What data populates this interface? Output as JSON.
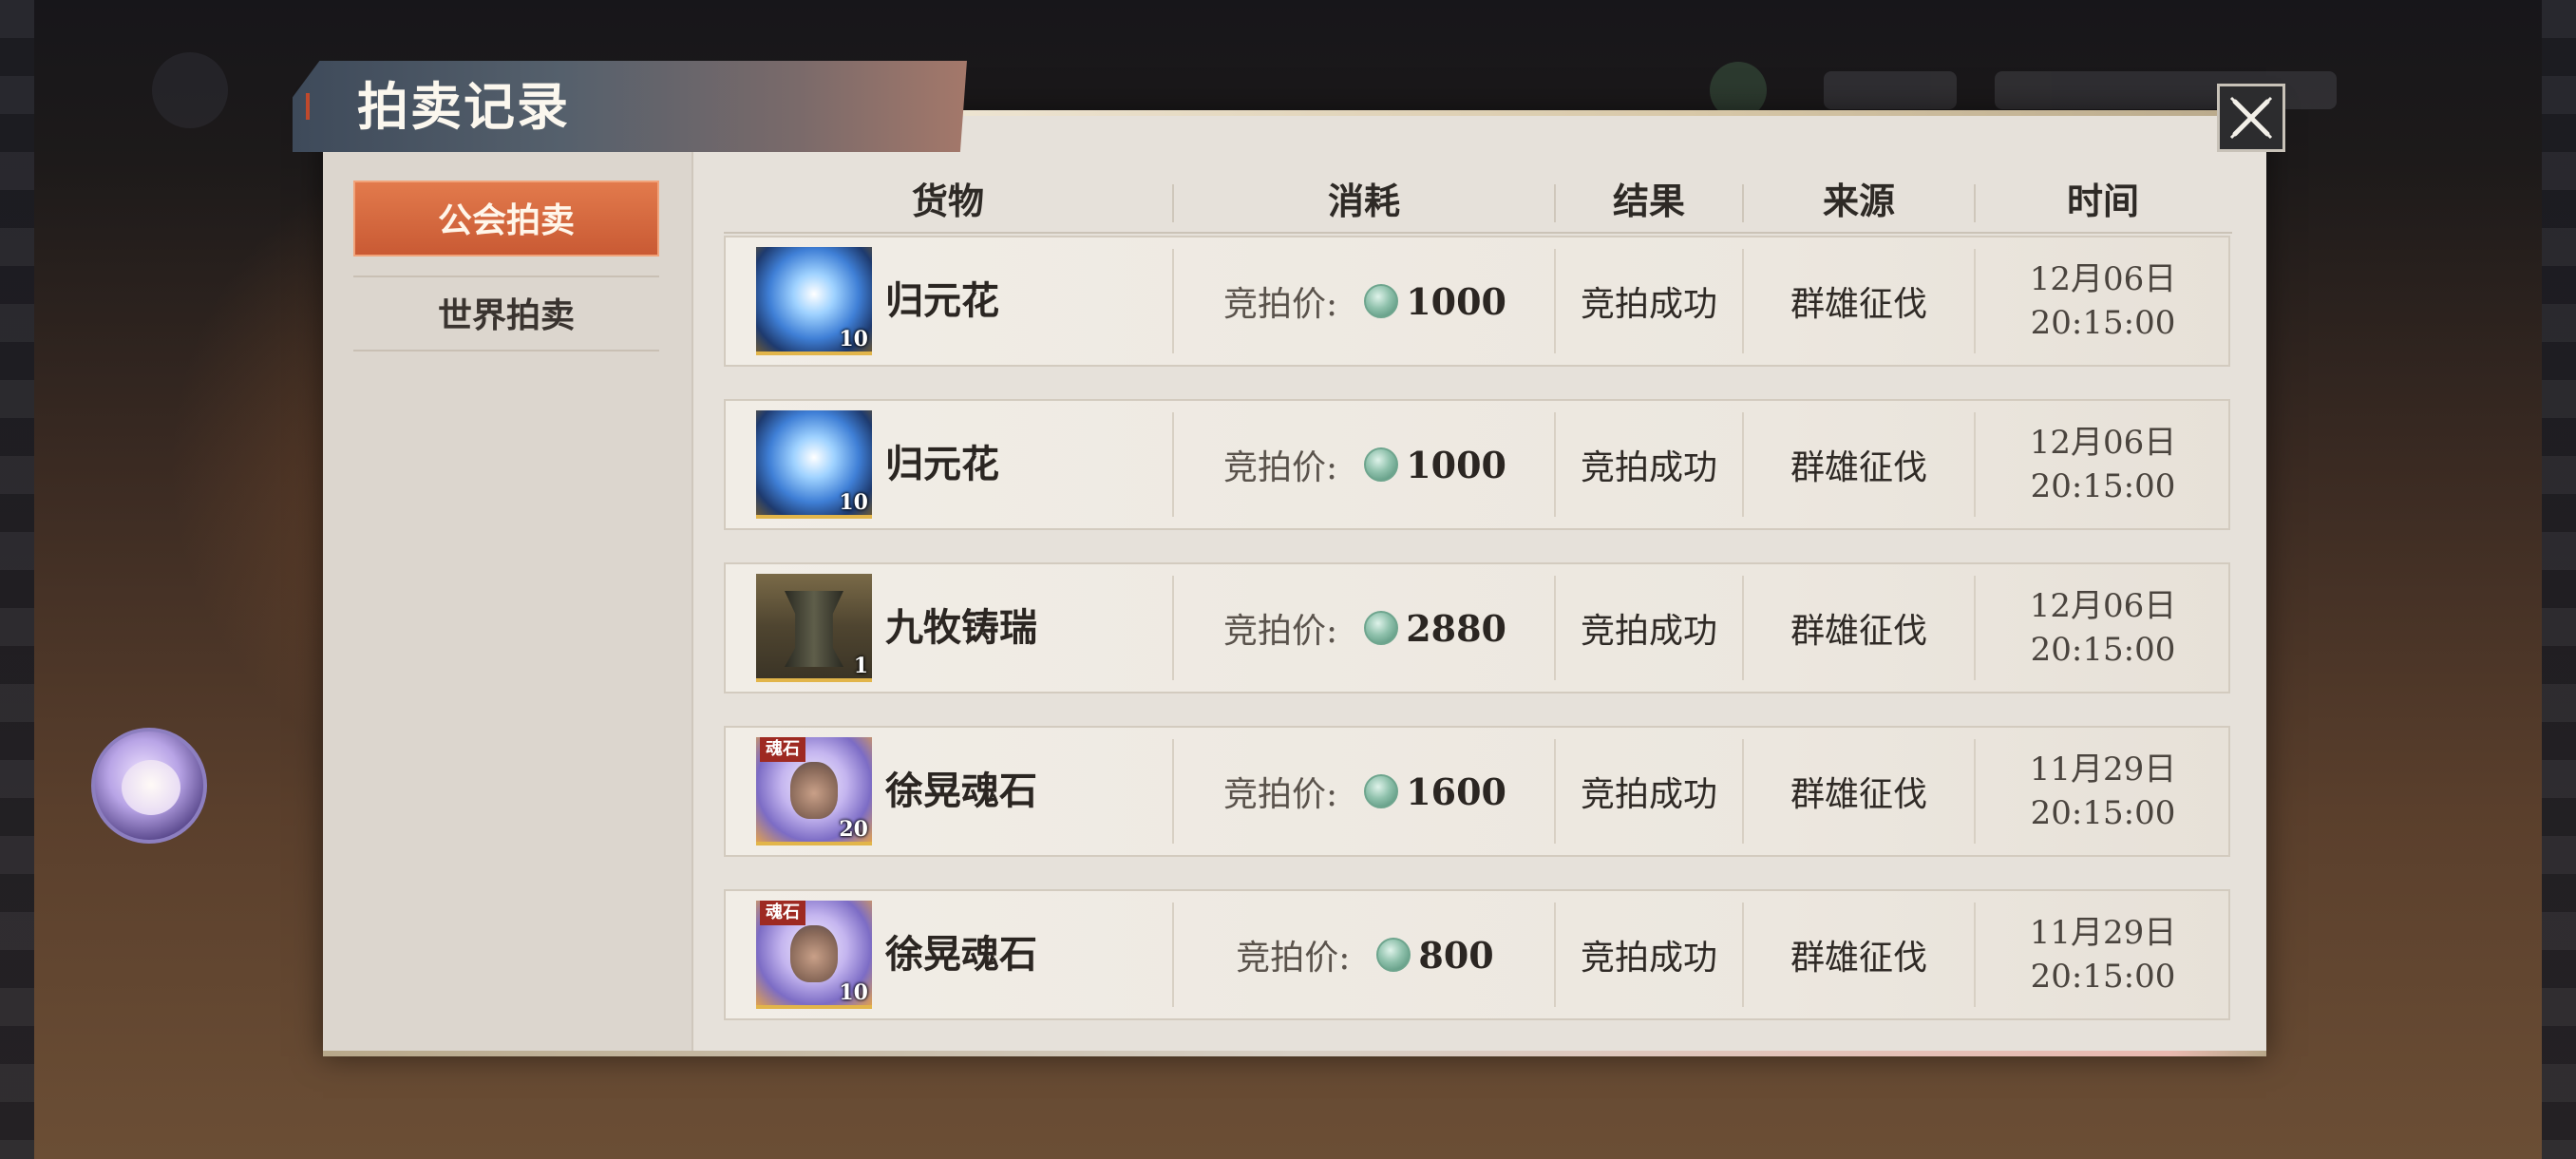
{
  "dialog": {
    "title": "拍卖记录",
    "close_icon": "close-x-icon"
  },
  "sidebar": {
    "tabs": [
      {
        "label": "公会拍卖",
        "active": true
      },
      {
        "label": "世界拍卖",
        "active": false
      }
    ]
  },
  "table": {
    "headers": [
      "货物",
      "消耗",
      "结果",
      "来源",
      "时间"
    ],
    "rows": [
      {
        "item": "归元花",
        "icon": "blue-flower-icon",
        "qty": "10",
        "tag": "",
        "cost_label": "竞拍价:",
        "cost": "1000",
        "result": "竞拍成功",
        "source": "群雄征伐",
        "date": "12月06日",
        "time": "20:15:00"
      },
      {
        "item": "归元花",
        "icon": "blue-flower-icon",
        "qty": "10",
        "tag": "",
        "cost_label": "竞拍价:",
        "cost": "1000",
        "result": "竞拍成功",
        "source": "群雄征伐",
        "date": "12月06日",
        "time": "20:15:00"
      },
      {
        "item": "九牧铸瑞",
        "icon": "bronze-vessel-icon",
        "qty": "1",
        "tag": "",
        "cost_label": "竞拍价:",
        "cost": "2880",
        "result": "竞拍成功",
        "source": "群雄征伐",
        "date": "12月06日",
        "time": "20:15:00"
      },
      {
        "item": "徐晃魂石",
        "icon": "soul-stone-portrait-icon",
        "qty": "20",
        "tag": "魂石",
        "cost_label": "竞拍价:",
        "cost": "1600",
        "result": "竞拍成功",
        "source": "群雄征伐",
        "date": "11月29日",
        "time": "20:15:00"
      },
      {
        "item": "徐晃魂石",
        "icon": "soul-stone-portrait-icon",
        "qty": "10",
        "tag": "魂石",
        "cost_label": "竞拍价:",
        "cost": "800",
        "result": "竞拍成功",
        "source": "群雄征伐",
        "date": "11月29日",
        "time": "20:15:00"
      }
    ]
  },
  "colors": {
    "active_tab": "#d8663c",
    "panel_bg": "#e6e1da",
    "currency": "#6ea58e"
  }
}
